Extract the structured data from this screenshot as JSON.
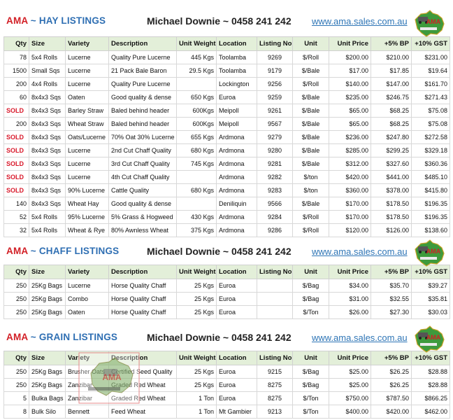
{
  "colors": {
    "brand_red": "#d21f26",
    "brand_blue": "#2f6fb3",
    "header_green": "#e3efd9",
    "link_blue": "#2e75b6",
    "sold_red": "#d9182a"
  },
  "contact": "Michael Downie  ~ 0458 241 242",
  "website": "www.ama.sales.com.au",
  "logo_icon": "ama-australia-map-logo",
  "columns": [
    "Qty",
    "Size",
    "Variety",
    "Description",
    "Unit Weight",
    "Location",
    "Listing No.",
    "Unit",
    "Unit Price",
    "+5% BP",
    "+10% GST"
  ],
  "hay": {
    "ama": "AMA",
    "title": " ~ HAY LISTINGS",
    "rows": [
      [
        "78",
        "5x4 Rolls",
        "Lucerne",
        "Quality Pure Lucerne",
        "445 Kgs",
        "Toolamba",
        "9269",
        "$/Roll",
        "$200.00",
        "$210.00",
        "$231.00"
      ],
      [
        "1500",
        "Small Sqs",
        "Lucerne",
        "21 Pack Bale Baron",
        "29.5 Kgs",
        "Toolamba",
        "9179",
        "$/Bale",
        "$17.00",
        "$17.85",
        "$19.64"
      ],
      [
        "200",
        "4x4 Rolls",
        "Lucerne",
        "Quality Pure Lucerne",
        "",
        "Lockington",
        "9256",
        "$/Roll",
        "$140.00",
        "$147.00",
        "$161.70"
      ],
      [
        "60",
        "8x4x3 Sqs",
        "Oaten",
        "Good quality & dense",
        "650 Kgs",
        "Euroa",
        "9259",
        "$/Bale",
        "$235.00",
        "$246.75",
        "$271.43"
      ],
      [
        "SOLD",
        "8x4x3 Sqs",
        "Barley Straw",
        "Baled behind header",
        "600Kgs",
        "Meipoll",
        "9261",
        "$/Bale",
        "$65.00",
        "$68.25",
        "$75.08"
      ],
      [
        "200",
        "8x4x3 Sqs",
        "Wheat Straw",
        "Baled behind header",
        "600Kgs",
        "Meipoll",
        "9567",
        "$/Bale",
        "$65.00",
        "$68.25",
        "$75.08"
      ],
      [
        "SOLD",
        "8x4x3 Sqs",
        "Oats/Lucerne",
        "70% Oat 30% Lucerne",
        "655 Kgs",
        "Ardmona",
        "9279",
        "$/Bale",
        "$236.00",
        "$247.80",
        "$272.58"
      ],
      [
        "SOLD",
        "8x4x3 Sqs",
        "Lucerne",
        "2nd Cut Chaff Quality",
        "680 Kgs",
        "Ardmona",
        "9280",
        "$/Bale",
        "$285.00",
        "$299.25",
        "$329.18"
      ],
      [
        "SOLD",
        "8x4x3 Sqs",
        "Lucerne",
        "3rd Cut Chaff Quality",
        "745 Kgs",
        "Ardmona",
        "9281",
        "$/Bale",
        "$312.00",
        "$327.60",
        "$360.36"
      ],
      [
        "SOLD",
        "8x4x3 Sqs",
        "Lucerne",
        "4th Cut Chaff Quality",
        "",
        "Ardmona",
        "9282",
        "$/ton",
        "$420.00",
        "$441.00",
        "$485.10"
      ],
      [
        "SOLD",
        "8x4x3 Sqs",
        "90% Lucerne",
        "Cattle Quality",
        "680 Kgs",
        "Ardmona",
        "9283",
        "$/ton",
        "$360.00",
        "$378.00",
        "$415.80"
      ],
      [
        "140",
        "8x4x3 Sqs",
        "Wheat Hay",
        "Good quality & dense",
        "",
        "Deniliquin",
        "9566",
        "$/Bale",
        "$170.00",
        "$178.50",
        "$196.35"
      ],
      [
        "52",
        "5x4 Rolls",
        "95% Lucerne",
        "5% Grass & Hogweed",
        "430 Kgs",
        "Ardmona",
        "9284",
        "$/Roll",
        "$170.00",
        "$178.50",
        "$196.35"
      ],
      [
        "32",
        "5x4 Rolls",
        "Wheat & Rye",
        "80% Awnless Wheat",
        "375 Kgs",
        "Ardmona",
        "9286",
        "$/Roll",
        "$120.00",
        "$126.00",
        "$138.60"
      ]
    ]
  },
  "chaff": {
    "ama": "AMA",
    "title": " ~ CHAFF LISTINGS",
    "rows": [
      [
        "250",
        "25Kg Bags",
        "Lucerne",
        "Horse Quality Chaff",
        "25 Kgs",
        "Euroa",
        "",
        "$/Bag",
        "$34.00",
        "$35.70",
        "$39.27"
      ],
      [
        "250",
        "25Kg Bags",
        "Combo",
        "Horse Quality Chaff",
        "25 Kgs",
        "Euroa",
        "",
        "$/Bag",
        "$31.00",
        "$32.55",
        "$35.81"
      ],
      [
        "250",
        "25Kg Bags",
        "Oaten",
        "Horse Quality Chaff",
        "25 Kgs",
        "Euroa",
        "",
        "$/Ton",
        "$26.00",
        "$27.30",
        "$30.03"
      ]
    ]
  },
  "grain": {
    "ama": "AMA",
    "title": " ~ GRAIN LISTINGS",
    "rows": [
      [
        "250",
        "25Kg Bags",
        "Brusher Oats",
        "Certified Seed Quality",
        "25 Kgs",
        "Euroa",
        "9215",
        "$/Bag",
        "$25.00",
        "$26.25",
        "$28.88"
      ],
      [
        "250",
        "25Kg Bags",
        "Zanzibar",
        "Graded Red Wheat",
        "25 Kgs",
        "Euroa",
        "8275",
        "$/Bag",
        "$25.00",
        "$26.25",
        "$28.88"
      ],
      [
        "5",
        "Bulka Bags",
        "Zanzibar",
        "Graded Red Wheat",
        "1 Ton",
        "Euroa",
        "8275",
        "$/Ton",
        "$750.00",
        "$787.50",
        "$866.25"
      ],
      [
        "8",
        "Bulk Silo",
        "Bennett",
        "Feed Wheat",
        "1 Ton",
        "Mt Gambier",
        "9213",
        "$/Ton",
        "$400.00",
        "$420.00",
        "$462.00"
      ]
    ]
  }
}
